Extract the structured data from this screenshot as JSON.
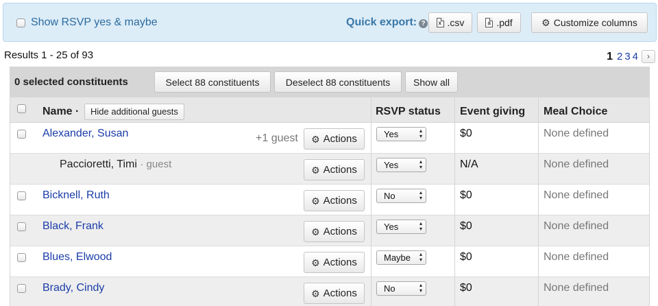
{
  "filter": {
    "label": "Show RSVP yes & maybe"
  },
  "export": {
    "label": "Quick export:",
    "help_icon": "?",
    "csv_label": ".csv",
    "pdf_label": ".pdf",
    "customize_label": "Customize columns"
  },
  "results": {
    "summary": "Results 1 - 25 of 93",
    "pages": [
      "1",
      "2",
      "3",
      "4"
    ],
    "next": "›"
  },
  "selection": {
    "count_text": "0 selected constituents",
    "select_label": "Select 88 constituents",
    "deselect_label": "Deselect 88 constituents",
    "show_all_label": "Show all"
  },
  "columns": {
    "name": "Name ·",
    "hide_guests": "Hide additional guests",
    "rsvp": "RSVP status",
    "giving": "Event giving",
    "meal": "Meal Choice"
  },
  "rows": [
    {
      "name": "Alexander, Susan",
      "guest_count": "+1 guest",
      "actions": "Actions",
      "rsvp": "Yes",
      "giving": "$0",
      "meal": "None defined"
    },
    {
      "name": "Paccioretti, Timi",
      "guest_tag": "· guest",
      "actions": "Actions",
      "rsvp": "Yes",
      "giving": "N/A",
      "meal": "None defined"
    },
    {
      "name": "Bicknell, Ruth",
      "actions": "Actions",
      "rsvp": "No",
      "giving": "$0",
      "meal": "None defined"
    },
    {
      "name": "Black, Frank",
      "actions": "Actions",
      "rsvp": "Yes",
      "giving": "$0",
      "meal": "None defined"
    },
    {
      "name": "Blues, Elwood",
      "actions": "Actions",
      "rsvp": "Maybe",
      "giving": "$0",
      "meal": "None defined"
    },
    {
      "name": "Brady, Cindy",
      "actions": "Actions",
      "rsvp": "No",
      "giving": "$0",
      "meal": "None defined"
    }
  ],
  "icons": {
    "actions": "gear-icon",
    "customize": "gear-icon",
    "csv": "csv-file-icon",
    "pdf": "pdf-file-icon",
    "help": "help-icon"
  },
  "colors": {
    "link": "#1a3ca8",
    "topbar_bg": "#dcedf8",
    "quick_export": "#3a77a6"
  }
}
